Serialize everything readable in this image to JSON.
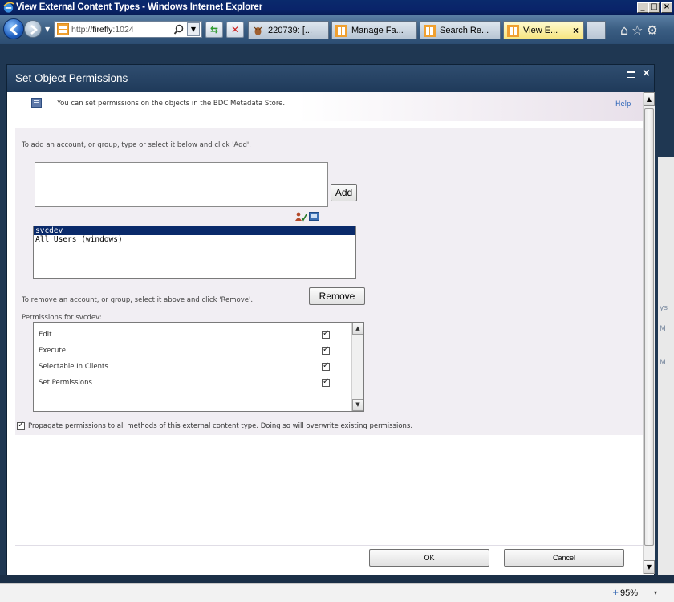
{
  "window": {
    "title": "View External Content Types - Windows Internet Explorer",
    "minimize": "_",
    "maximize": "□",
    "close": "×"
  },
  "browser": {
    "url_prefix": "http://",
    "url_host": "firefly",
    "url_suffix": ":1024",
    "tabs": [
      {
        "label": "220739: [...",
        "icon": "bug-icon",
        "active": false
      },
      {
        "label": "Manage Fa...",
        "icon": "sharepoint-icon",
        "active": false
      },
      {
        "label": "Search Re...",
        "icon": "sharepoint-icon",
        "active": false
      },
      {
        "label": "View E...",
        "icon": "sharepoint-icon",
        "active": true
      }
    ],
    "close_tab": "×"
  },
  "dialog": {
    "title": "Set Object Permissions",
    "info_text": "You can set permissions on the objects in the BDC Metadata Store.",
    "help_link": "Help",
    "add_instruction": "To add an account, or group, type or select it below and click 'Add'.",
    "people_input_value": "",
    "add_button": "Add",
    "accounts": [
      {
        "name": "svcdev",
        "selected": true
      },
      {
        "name": "All Users (windows)",
        "selected": false
      }
    ],
    "remove_instruction": "To remove an account, or group, select it above and click 'Remove'.",
    "remove_button": "Remove",
    "permissions_label": "Permissions for svcdev:",
    "permissions": [
      {
        "name": "Edit",
        "checked": true
      },
      {
        "name": "Execute",
        "checked": true
      },
      {
        "name": "Selectable In Clients",
        "checked": true
      },
      {
        "name": "Set Permissions",
        "checked": true
      }
    ],
    "propagate_text": "Propagate permissions to all methods of this external content type. Doing so will overwrite existing permissions.",
    "propagate_checked": true,
    "ok_button": "OK",
    "cancel_button": "Cancel"
  },
  "background_fragments": {
    "frag1": "ys",
    "frag2": "M",
    "frag3": "M"
  },
  "status": {
    "zoom": "95%",
    "zoom_dropdown": "▾"
  },
  "colors": {
    "window_titlebar": "#0a246a",
    "dialog_header": "#2a4669",
    "content_bg": "#f1eef3",
    "selection": "#0a2a6a",
    "link": "#2a64b8"
  }
}
